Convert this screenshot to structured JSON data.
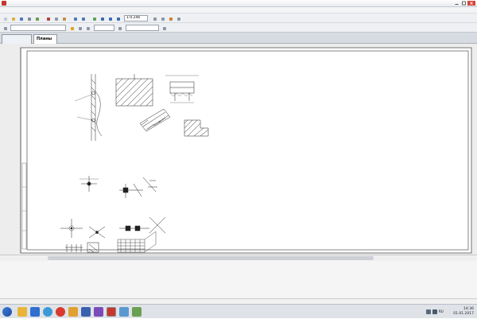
{
  "window": {
    "title": "",
    "icon": "app-logo-icon",
    "controls": [
      "minimize-icon",
      "maximize-icon",
      "close-icon"
    ]
  },
  "menu": {
    "items": [
      "",
      "",
      "",
      "",
      "",
      "",
      "",
      "",
      "",
      "",
      "",
      ""
    ]
  },
  "toolbar": {
    "line_style_field": "",
    "zoom_field": "1:0.246",
    "coord_field": ""
  },
  "tabs": [
    {
      "label": "",
      "active": false
    },
    {
      "label": "Планы",
      "active": true
    }
  ],
  "document": {
    "path_label": "",
    "section_title": "",
    "calc_title": "",
    "calc_params": [
      "",
      "",
      "",
      "",
      "",
      "",
      "",
      "",
      "",
      "",
      "",
      "",
      "",
      "",
      "",
      "",
      "",
      "",
      "",
      ""
    ],
    "formula_lines": [
      "",
      "",
      "",
      "",
      "",
      "",
      "",
      "",
      "",
      "",
      "",
      "",
      "",
      ""
    ],
    "notes": [
      "",
      "",
      ""
    ],
    "figure_numbers": [
      "",
      "",
      "",
      "",
      "",
      "",
      "",
      "",
      "",
      "",
      ""
    ],
    "callouts": [
      "",
      "",
      "",
      "",
      "",
      "",
      "",
      "",
      "",
      "",
      "",
      ""
    ]
  },
  "status": {
    "text": ""
  },
  "taskbar": {
    "apps": [
      "folder-icon",
      "media-icon",
      "browser-icon",
      "yandex-icon",
      "mail-icon",
      "office-icon",
      "viewer-icon",
      "cad-icon",
      "explorer-icon",
      "app-icon"
    ],
    "time": "14:36",
    "date": "01.01.2017",
    "language": "RU"
  }
}
